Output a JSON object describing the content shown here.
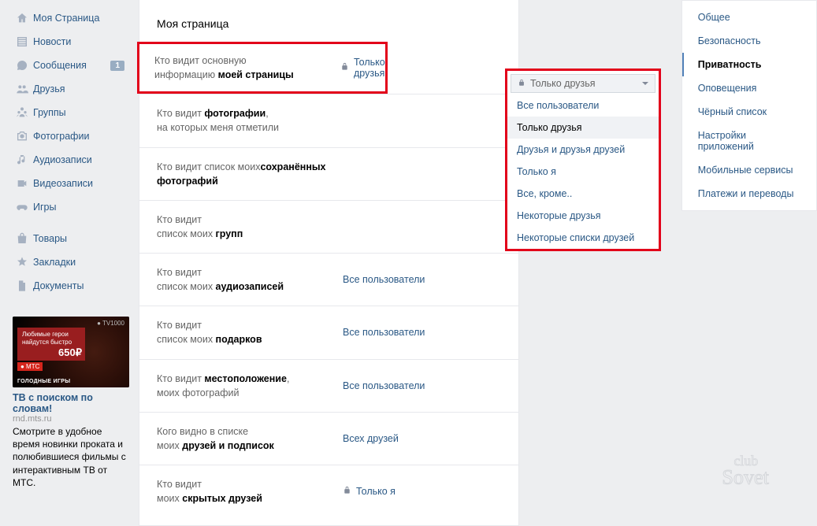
{
  "left_nav": {
    "items": [
      {
        "icon": "home",
        "label": "Моя Страница"
      },
      {
        "icon": "news",
        "label": "Новости"
      },
      {
        "icon": "msg",
        "label": "Сообщения",
        "badge": "1"
      },
      {
        "icon": "friends",
        "label": "Друзья"
      },
      {
        "icon": "groups",
        "label": "Группы"
      },
      {
        "icon": "photos",
        "label": "Фотографии"
      },
      {
        "icon": "audio",
        "label": "Аудиозаписи"
      },
      {
        "icon": "video",
        "label": "Видеозаписи"
      },
      {
        "icon": "games",
        "label": "Игры"
      }
    ],
    "items2": [
      {
        "icon": "market",
        "label": "Товары"
      },
      {
        "icon": "fav",
        "label": "Закладки"
      },
      {
        "icon": "docs",
        "label": "Документы"
      }
    ]
  },
  "ad": {
    "tv": "● TV1000",
    "red_line1": "Любимые герои",
    "red_line2": "найдутся быстро",
    "price": "650₽",
    "mts": "● МТС",
    "over_title": "ГОЛОДНЫЕ ИГРЫ",
    "title": "ТВ с поиском по словам!",
    "host": "rnd.mts.ru",
    "text": "Смотрите в удобное время новинки проката и полюбившиеся фильмы с интерактивным ТВ от МТС."
  },
  "main": {
    "title": "Моя страница",
    "rows": [
      {
        "l1": "Кто видит основную",
        "l2": "информацию ",
        "b": "моей страницы",
        "highlight": true,
        "val": "Только друзья",
        "lock": true
      },
      {
        "l1": "Кто видит ",
        "b1": "фотографии",
        "l2": "на которых меня отметили",
        "val": ""
      },
      {
        "l1": "Кто видит список моих",
        "b": "сохранённых фотографий",
        "val": ""
      },
      {
        "l1": "Кто видит",
        "l2": "список моих ",
        "b": "групп",
        "val": ""
      },
      {
        "l1": "Кто видит",
        "l2": "список моих ",
        "b": "аудиозаписей",
        "val": "Все пользователи"
      },
      {
        "l1": "Кто видит",
        "l2": "список моих ",
        "b": "подарков",
        "val": "Все пользователи"
      },
      {
        "l1": "Кто видит ",
        "b1": "местоположение",
        "l2": "моих фотографий",
        "val": "Все пользователи"
      },
      {
        "l1": "Кого видно в списке",
        "l2": "моих ",
        "b": "друзей и подписок",
        "val": "Всех друзей"
      },
      {
        "l1": "Кто видит",
        "l2": "моих ",
        "b": "скрытых друзей",
        "val": "Только я",
        "lock": true
      }
    ]
  },
  "dropdown": {
    "selected": "Только друзья",
    "options": [
      "Все пользователи",
      "Только друзья",
      "Друзья и друзья друзей",
      "Только я",
      "Все, кроме..",
      "Некоторые друзья",
      "Некоторые списки друзей"
    ]
  },
  "right": {
    "items": [
      "Общее",
      "Безопасность",
      "Приватность",
      "Оповещения",
      "Чёрный список",
      "Настройки приложений",
      "Мобильные сервисы",
      "Платежи и переводы"
    ],
    "active": 2
  }
}
